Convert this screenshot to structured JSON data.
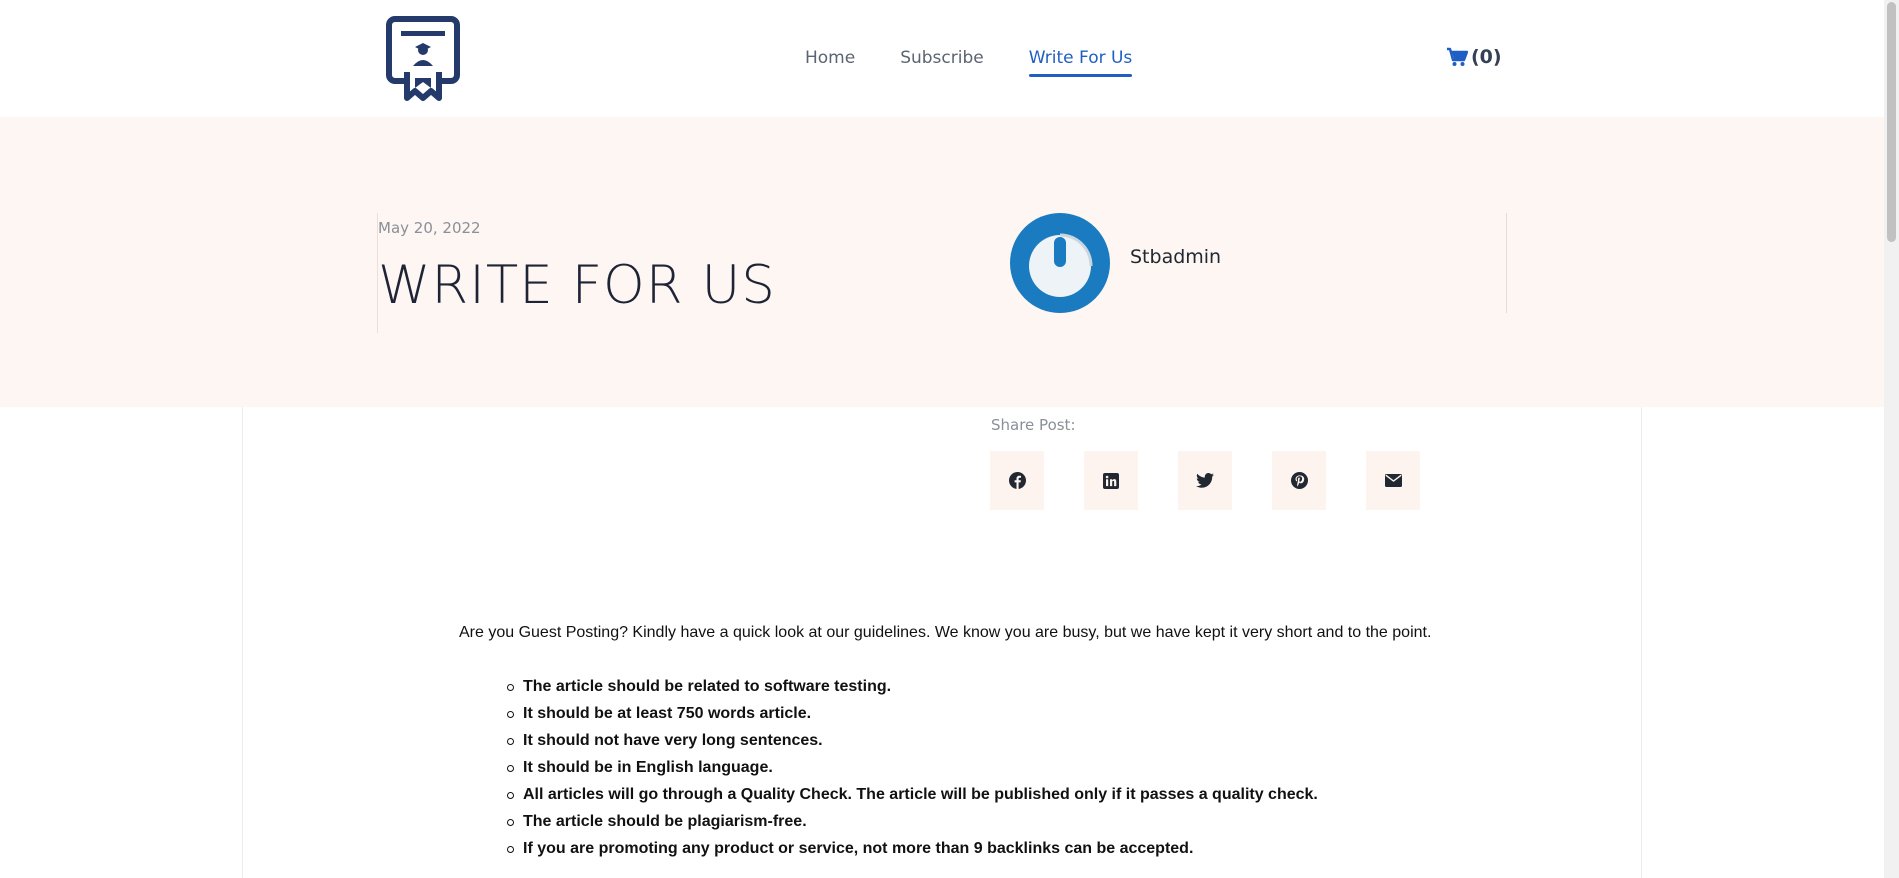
{
  "header": {
    "logo": "certificate-logo-icon",
    "nav": [
      "Home",
      "Subscribe",
      "Write For Us"
    ],
    "active_nav": "Write For Us",
    "cart_label": "(0)"
  },
  "post": {
    "date": "May 20, 2022",
    "title": "WRITE FOR US",
    "author": "Stbadmin"
  },
  "share": {
    "label": "Share Post:",
    "icons": [
      "facebook-icon",
      "linkedin-icon",
      "twitter-icon",
      "pinterest-icon",
      "envelope-icon"
    ]
  },
  "content": {
    "intro": "Are you Guest Posting? Kindly have a quick look at our guidelines. We know you are busy, but we have kept it very short and to the point.",
    "rules": [
      "The article should be related to software testing.",
      "It should be at least 750 words article.",
      "It should not have very long sentences.",
      "It should be in English language.",
      "All articles will go through a Quality Check. The article will be published only if it passes a quality check.",
      "The article should be plagiarism-free.",
      "If you are promoting any product or service, not more than 9 backlinks can be accepted."
    ]
  },
  "colors": {
    "accent": "#1f5fc4",
    "logo": "#243a6b",
    "hero_bg": "#fdf6f2",
    "avatar": "#1a7bc1"
  }
}
